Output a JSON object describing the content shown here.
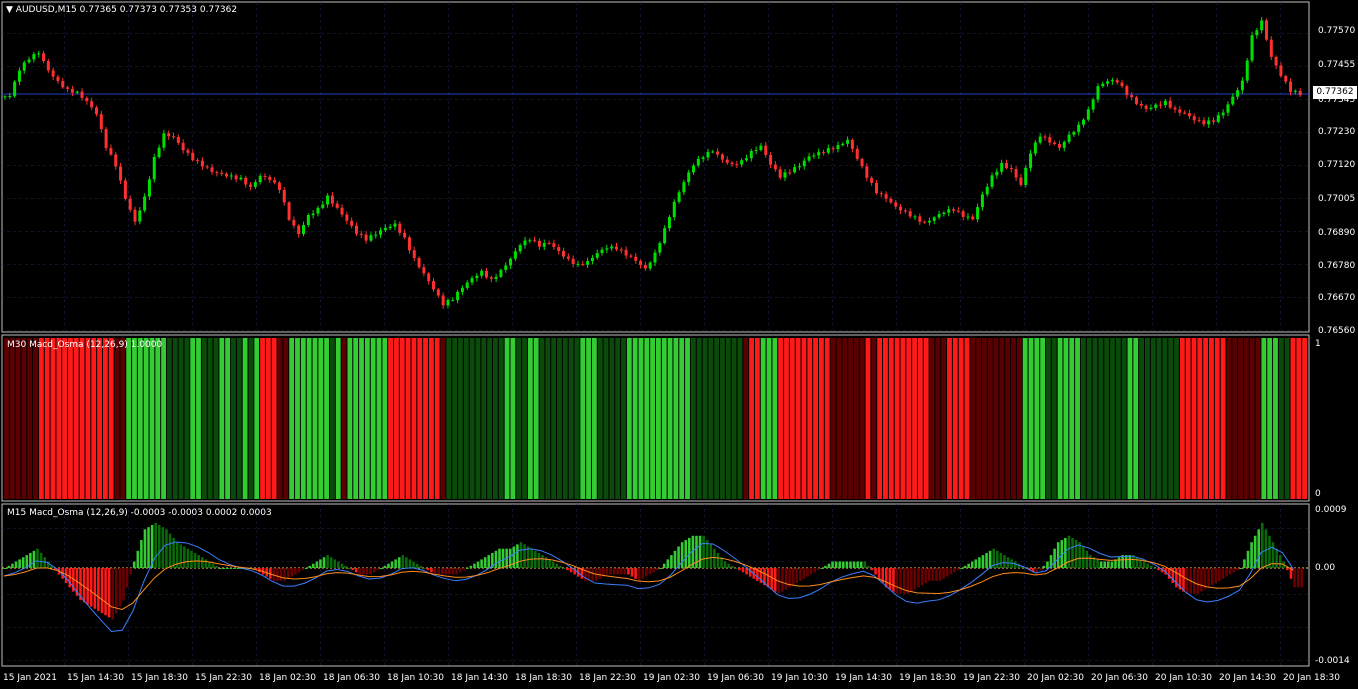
{
  "main": {
    "header": {
      "arrow": "▼",
      "text": "AUDUSD,M15  0.77365 0.77373 0.77353 0.77362"
    },
    "price_axis": [
      "0.77570",
      "0.77455",
      "0.77345",
      "0.77230",
      "0.77120",
      "0.77005",
      "0.76890",
      "0.76780",
      "0.76670",
      "0.76560"
    ],
    "current_price": "0.77362"
  },
  "mid": {
    "header": "M30  Macd_Osma (12,26,9) 1.0000",
    "axis": [
      "1",
      "0"
    ],
    "segments": [
      {
        "c": "darkred",
        "n": 6
      },
      {
        "c": "red",
        "n": 13
      },
      {
        "c": "darkred",
        "n": 2
      },
      {
        "c": "green",
        "n": 7
      },
      {
        "c": "darkgreen",
        "n": 4
      },
      {
        "c": "green",
        "n": 2
      },
      {
        "c": "darkgreen",
        "n": 3
      },
      {
        "c": "green",
        "n": 2
      },
      {
        "c": "darkgreen",
        "n": 2
      },
      {
        "c": "green",
        "n": 1
      },
      {
        "c": "darkgreen",
        "n": 1
      },
      {
        "c": "green",
        "n": 1
      },
      {
        "c": "red",
        "n": 3
      },
      {
        "c": "darkred",
        "n": 2
      },
      {
        "c": "green",
        "n": 7
      },
      {
        "c": "darkgreen",
        "n": 1
      },
      {
        "c": "green",
        "n": 1
      },
      {
        "c": "darkred",
        "n": 1
      },
      {
        "c": "green",
        "n": 7
      },
      {
        "c": "red",
        "n": 9
      },
      {
        "c": "darkred",
        "n": 1
      },
      {
        "c": "darkgreen",
        "n": 10
      },
      {
        "c": "green",
        "n": 2
      },
      {
        "c": "darkgreen",
        "n": 2
      },
      {
        "c": "green",
        "n": 2
      },
      {
        "c": "darkgreen",
        "n": 7
      },
      {
        "c": "green",
        "n": 3
      },
      {
        "c": "darkgreen",
        "n": 5
      },
      {
        "c": "green",
        "n": 11
      },
      {
        "c": "darkgreen",
        "n": 9
      },
      {
        "c": "darkred",
        "n": 1
      },
      {
        "c": "red",
        "n": 2
      },
      {
        "c": "green",
        "n": 3
      },
      {
        "c": "red",
        "n": 9
      },
      {
        "c": "darkred",
        "n": 6
      },
      {
        "c": "red",
        "n": 1
      },
      {
        "c": "darkred",
        "n": 1
      },
      {
        "c": "red",
        "n": 9
      },
      {
        "c": "darkred",
        "n": 3
      },
      {
        "c": "red",
        "n": 4
      },
      {
        "c": "darkred",
        "n": 9
      },
      {
        "c": "green",
        "n": 4
      },
      {
        "c": "darkgreen",
        "n": 2
      },
      {
        "c": "green",
        "n": 4
      },
      {
        "c": "darkgreen",
        "n": 8
      },
      {
        "c": "green",
        "n": 2
      },
      {
        "c": "darkgreen",
        "n": 7
      },
      {
        "c": "red",
        "n": 8
      },
      {
        "c": "darkred",
        "n": 6
      },
      {
        "c": "green",
        "n": 3
      },
      {
        "c": "darkgreen",
        "n": 2
      },
      {
        "c": "red",
        "n": 3
      }
    ]
  },
  "bottom": {
    "header": "M15  Macd_Osma (12,26,9) -0.0003 -0.0003 0.0002 0.0003",
    "axis": [
      "0.0009",
      "0.00",
      "-0.0014"
    ]
  },
  "time_axis": [
    "15 Jan 2021",
    "15 Jan 14:30",
    "15 Jan 18:30",
    "15 Jan 22:30",
    "18 Jan 02:30",
    "18 Jan 06:30",
    "18 Jan 10:30",
    "18 Jan 14:30",
    "18 Jan 18:30",
    "18 Jan 22:30",
    "19 Jan 02:30",
    "19 Jan 06:30",
    "19 Jan 10:30",
    "19 Jan 14:30",
    "19 Jan 18:30",
    "19 Jan 22:30",
    "20 Jan 02:30",
    "20 Jan 06:30",
    "20 Jan 10:30",
    "20 Jan 14:30",
    "20 Jan 18:30"
  ],
  "chart_data": {
    "type": "candlestick",
    "price_close_path": [
      0.7735,
      0.7744,
      0.7748,
      0.775,
      0.7744,
      0.774,
      0.7737,
      0.7736,
      0.7733,
      0.7729,
      0.7718,
      0.7712,
      0.7701,
      0.7693,
      0.7701,
      0.7714,
      0.7722,
      0.7721,
      0.7717,
      0.7714,
      0.7712,
      0.771,
      0.7709,
      0.7708,
      0.7707,
      0.7704,
      0.7708,
      0.7707,
      0.7704,
      0.7694,
      0.7689,
      0.7695,
      0.7697,
      0.7701,
      0.7697,
      0.7693,
      0.7689,
      0.7687,
      0.7689,
      0.7691,
      0.7692,
      0.7687,
      0.768,
      0.7675,
      0.767,
      0.7665,
      0.7667,
      0.7671,
      0.7674,
      0.7676,
      0.7673,
      0.7676,
      0.768,
      0.7685,
      0.7687,
      0.7685,
      0.7686,
      0.7683,
      0.768,
      0.7678,
      0.7679,
      0.7682,
      0.7684,
      0.7684,
      0.7682,
      0.768,
      0.7677,
      0.7682,
      0.769,
      0.7699,
      0.7706,
      0.7712,
      0.7715,
      0.7717,
      0.7714,
      0.7712,
      0.7713,
      0.7716,
      0.7718,
      0.7712,
      0.7708,
      0.771,
      0.7712,
      0.7715,
      0.7716,
      0.7717,
      0.7718,
      0.772,
      0.7714,
      0.7708,
      0.7703,
      0.7701,
      0.7698,
      0.7696,
      0.7694,
      0.7692,
      0.7694,
      0.7696,
      0.7697,
      0.7695,
      0.7694,
      0.7702,
      0.7708,
      0.7712,
      0.771,
      0.7705,
      0.7716,
      0.7722,
      0.772,
      0.7718,
      0.7722,
      0.7725,
      0.773,
      0.7738,
      0.774,
      0.774,
      0.7736,
      0.7733,
      0.7731,
      0.7732,
      0.7733,
      0.773,
      0.7729,
      0.7727,
      0.7726,
      0.7727,
      0.773,
      0.7735,
      0.774,
      0.7755,
      0.776,
      0.7748,
      0.7742,
      0.7737,
      0.7736
    ],
    "pane1": {
      "zero": 0,
      "top": 1
    },
    "macd_hist_path": [
      0.0,
      0.0001,
      0.0002,
      0.0003,
      0.0001,
      -0.0001,
      -0.0003,
      -0.0005,
      -0.0006,
      -0.0007,
      -0.0008,
      -0.0005,
      0.0001,
      0.0006,
      0.0007,
      0.0006,
      0.0004,
      0.0003,
      0.0002,
      0.0001,
      0.0,
      0.0,
      0.0,
      0.0,
      -0.0001,
      -0.0002,
      -0.0002,
      -0.0001,
      0.0,
      0.0001,
      0.0002,
      0.0001,
      0.0,
      -0.0001,
      -0.0001,
      0.0,
      0.0001,
      0.0002,
      0.0001,
      0.0,
      -0.0001,
      -0.0001,
      -0.0001,
      0.0,
      0.0001,
      0.0002,
      0.0003,
      0.0003,
      0.0004,
      0.0003,
      0.0002,
      0.0001,
      0.0,
      -0.0001,
      -0.0002,
      -0.0002,
      -0.0001,
      -0.0001,
      -0.0001,
      -0.0002,
      -0.0001,
      0.0,
      0.0002,
      0.0004,
      0.0005,
      0.0005,
      0.0003,
      0.0001,
      0.0,
      -0.0001,
      -0.0002,
      -0.0003,
      -0.0004,
      -0.0003,
      -0.0002,
      -0.0001,
      0.0,
      0.0001,
      0.0001,
      0.0001,
      0.0001,
      -0.0001,
      -0.0003,
      -0.0004,
      -0.0004,
      -0.0003,
      -0.0002,
      -0.0002,
      -0.0001,
      0.0,
      0.0001,
      0.0002,
      0.0003,
      0.0002,
      0.0001,
      0.0,
      -0.0001,
      0.0001,
      0.0004,
      0.0005,
      0.0004,
      0.0002,
      0.0001,
      0.0001,
      0.0002,
      0.0002,
      0.0001,
      0.0,
      -0.0001,
      -0.0003,
      -0.0004,
      -0.0004,
      -0.0003,
      -0.0002,
      -0.0001,
      0.0,
      0.0004,
      0.0007,
      0.0004,
      0.0001,
      -0.0003
    ]
  }
}
